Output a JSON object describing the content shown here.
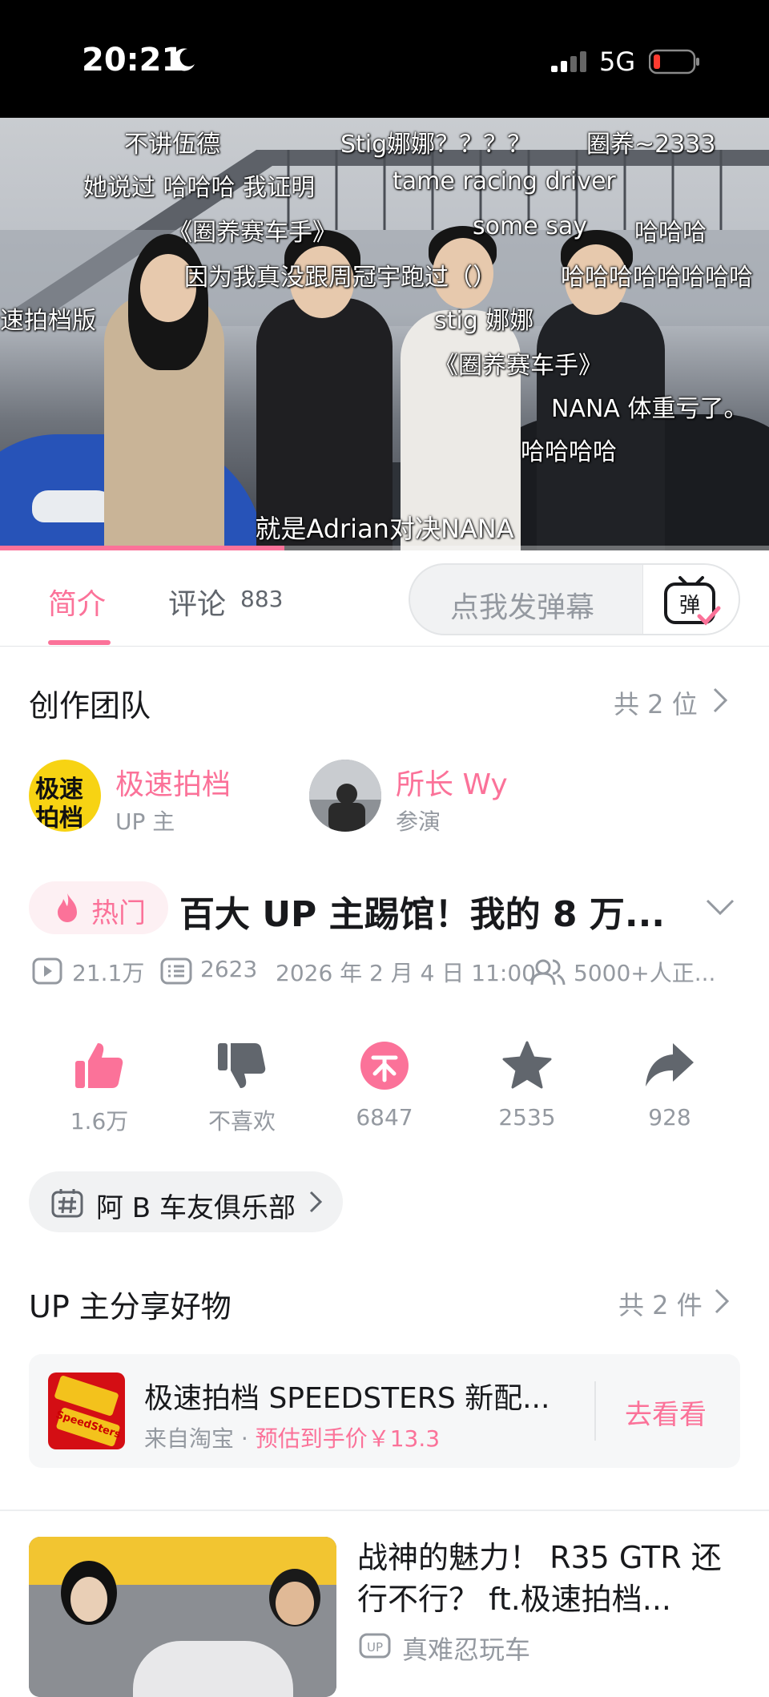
{
  "status_bar": {
    "time": "20:21",
    "network": "5G"
  },
  "video": {
    "progress_fraction": 0.37,
    "danmaku": [
      "不讲伍德",
      "Stig娜娜？？？？",
      "圈养~2333",
      "她说过 哈哈哈 我证明",
      "tame racing driver",
      "《圈养赛车手》",
      "some say",
      "哈哈哈",
      "因为我真没跟周冠宇跑过（）",
      "哈哈哈哈哈哈哈哈",
      "速拍档版",
      "stig 娜娜",
      "《圈养赛车手》",
      "NANA 体重亏了。",
      "哈哈哈哈"
    ],
    "subtitle": "就是Adrian对决NANA"
  },
  "tabs": {
    "intro": "简介",
    "comments": "评论",
    "comments_count": "883",
    "danmaku_placeholder": "点我发弹幕",
    "danmaku_button": "弹"
  },
  "team": {
    "title": "创作团队",
    "more": "共 2 位",
    "members": [
      {
        "name": "极速拍档",
        "role": "UP 主",
        "avatar_text_1": "极速",
        "avatar_text_2": "拍档"
      },
      {
        "name": "所长 Wy",
        "role": "参演"
      }
    ]
  },
  "video_info": {
    "hot_label": "热门",
    "title": "百大 UP 主踢馆！我的 8 万...",
    "views": "21.1万",
    "danmaku_count": "2623",
    "publish_time": "2026 年 2 月 4 日 11:00",
    "watching": "5000+人正..."
  },
  "actions": [
    {
      "name": "like",
      "label": "1.6万"
    },
    {
      "name": "dislike",
      "label": "不喜欢"
    },
    {
      "name": "coin",
      "label": "6847"
    },
    {
      "name": "favorite",
      "label": "2535"
    },
    {
      "name": "share",
      "label": "928"
    }
  ],
  "tag": {
    "label": "阿 B 车友俱乐部"
  },
  "goods": {
    "section_title": "UP 主分享好物",
    "more": "共 2 件",
    "item_title": "极速拍档 SPEEDSTERS 新配...",
    "source": "来自淘宝 · ",
    "price": "预估到手价￥13.3",
    "button": "去看看",
    "thumb_text": "SpeedSters"
  },
  "related": {
    "title": "战神的魅力！ R35 GTR 还行不行？ ft.极速拍档...",
    "author": "真难忍玩车",
    "up_badge": "UP"
  },
  "colors": {
    "accent": "#fb7299",
    "text_primary": "#18191c",
    "text_secondary": "#9499a0"
  }
}
